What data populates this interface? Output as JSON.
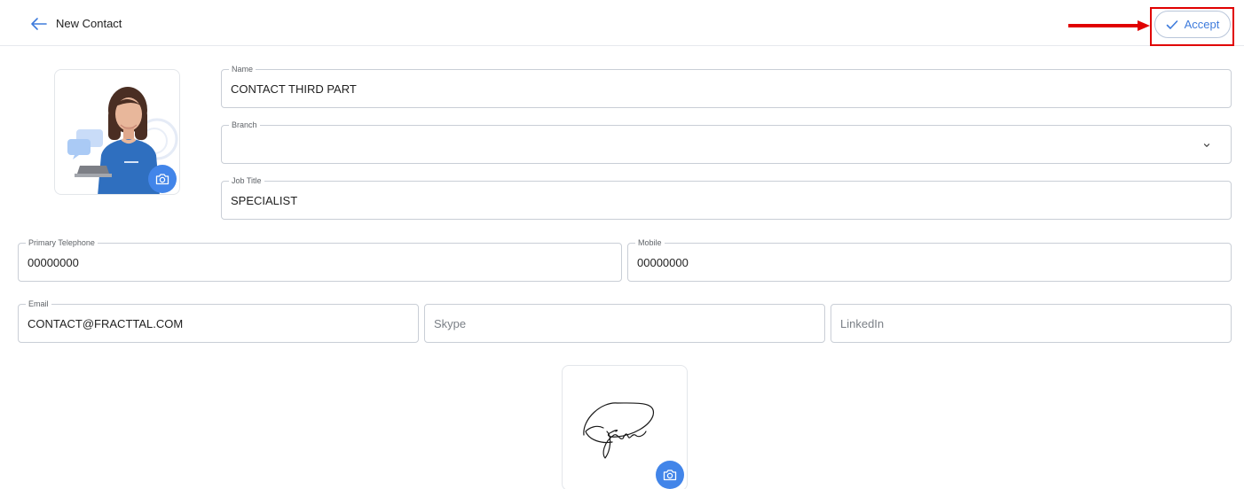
{
  "header": {
    "title": "New Contact",
    "accept_label": "Accept"
  },
  "colors": {
    "accent": "#3e7bdc",
    "camera_button": "#4285e9",
    "annotation_red": "#e00000"
  },
  "icons": {
    "back": "arrow-left-icon",
    "accept": "check-icon",
    "camera": "camera-icon",
    "dropdown": "chevron-down-icon"
  },
  "form": {
    "name": {
      "label": "Name",
      "value": "CONTACT THIRD PART"
    },
    "branch": {
      "label": "Branch",
      "value": ""
    },
    "job_title": {
      "label": "Job Title",
      "value": "SPECIALIST"
    },
    "primary_telephone": {
      "label": "Primary Telephone",
      "value": "00000000"
    },
    "mobile": {
      "label": "Mobile",
      "value": "00000000"
    },
    "email": {
      "label": "Email",
      "value": "CONTACT@FRACTTAL.COM"
    },
    "skype": {
      "placeholder": "Skype"
    },
    "linkedin": {
      "placeholder": "LinkedIn"
    }
  }
}
